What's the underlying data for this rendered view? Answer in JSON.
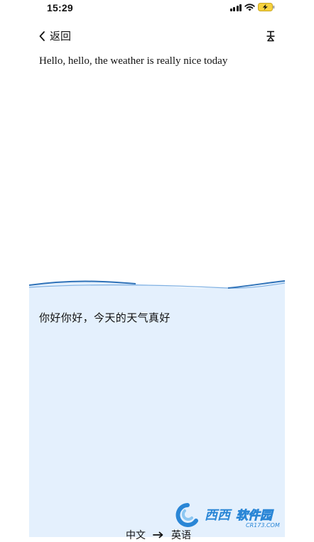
{
  "status_bar": {
    "time": "15:29"
  },
  "nav": {
    "back_label": "返回",
    "back_icon": "chevron-left-icon",
    "right_icon": "clear-format-icon"
  },
  "source": {
    "text": "Hello, hello, the weather is really nice today"
  },
  "result": {
    "text": "你好你好，今天的天气真好"
  },
  "language_switch": {
    "from": "中文",
    "to": "英语",
    "arrow_icon": "arrow-right-icon"
  },
  "watermark": {
    "text": "西西软件园",
    "sub_text": "CR173.COM"
  },
  "colors": {
    "panel_background": "#e4f0fd",
    "wave_dark": "#2f72b8",
    "wave_light": "#7fb0e2",
    "watermark_blue": "#2a86d6"
  }
}
